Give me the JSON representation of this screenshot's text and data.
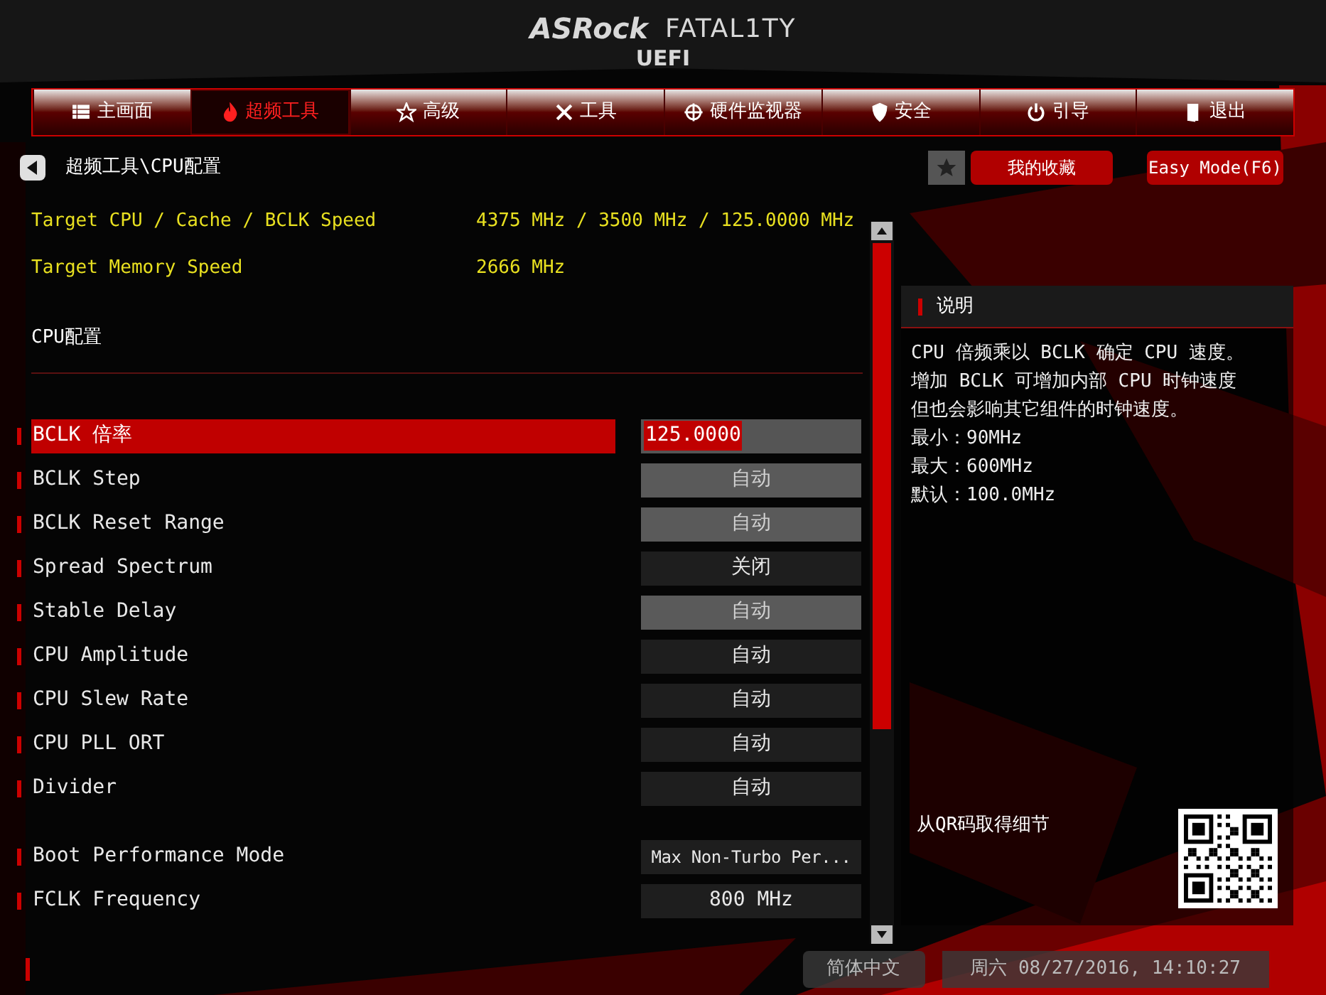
{
  "header": {
    "brand": "ASRock",
    "product": "FATAL1TY",
    "subtitle": "UEFI"
  },
  "tabs": [
    {
      "label": "主画面",
      "selected": false
    },
    {
      "label": "超频工具",
      "selected": true
    },
    {
      "label": "高级",
      "selected": false
    },
    {
      "label": "工具",
      "selected": false
    },
    {
      "label": "硬件监视器",
      "selected": false
    },
    {
      "label": "安全",
      "selected": false
    },
    {
      "label": "引导",
      "selected": false
    },
    {
      "label": "退出",
      "selected": false
    }
  ],
  "breadcrumb": "超频工具\\CPU配置",
  "favorites_button": "我的收藏",
  "easy_mode_button": "Easy Mode(F6)",
  "info_rows": [
    {
      "label": "Target CPU / Cache / BCLK Speed",
      "value": "4375 MHz / 3500 MHz / 125.0000 MHz"
    },
    {
      "label": "Target Memory Speed",
      "value": "2666 MHz"
    }
  ],
  "section_title": "CPU配置",
  "settings_groups": [
    [
      {
        "label": "BCLK 倍率",
        "value": "125.0000",
        "kind": "input",
        "selected": true,
        "disabled": false
      },
      {
        "label": "BCLK Step",
        "value": "自动",
        "kind": "select",
        "selected": false,
        "disabled": true
      },
      {
        "label": "BCLK Reset Range",
        "value": "自动",
        "kind": "select",
        "selected": false,
        "disabled": true
      },
      {
        "label": "Spread Spectrum",
        "value": "关闭",
        "kind": "select",
        "selected": false,
        "disabled": false
      },
      {
        "label": "Stable Delay",
        "value": "自动",
        "kind": "select",
        "selected": false,
        "disabled": true
      },
      {
        "label": "CPU Amplitude",
        "value": "自动",
        "kind": "select",
        "selected": false,
        "disabled": false
      },
      {
        "label": "CPU Slew Rate",
        "value": "自动",
        "kind": "select",
        "selected": false,
        "disabled": false
      },
      {
        "label": "CPU PLL ORT",
        "value": "自动",
        "kind": "select",
        "selected": false,
        "disabled": false
      },
      {
        "label": "Divider",
        "value": "自动",
        "kind": "select",
        "selected": false,
        "disabled": false
      }
    ],
    [
      {
        "label": "Boot Performance Mode",
        "value": "Max Non-Turbo Per...",
        "kind": "select",
        "selected": false,
        "disabled": false
      },
      {
        "label": "FCLK Frequency",
        "value": "800 MHz",
        "kind": "select",
        "selected": false,
        "disabled": false
      }
    ]
  ],
  "description": {
    "title": "说明",
    "lines": [
      "CPU 倍频乘以 BCLK 确定 CPU 速度。",
      "增加 BCLK 可增加内部 CPU 时钟速度",
      "但也会影响其它组件的时钟速度。",
      "最小：90MHz",
      "最大：600MHz",
      "默认：100.0MHz"
    ],
    "qr_caption": "从QR码取得细节"
  },
  "status_bar": {
    "language": "简体中文",
    "datetime": "周六 08/27/2016, 14:10:27"
  }
}
